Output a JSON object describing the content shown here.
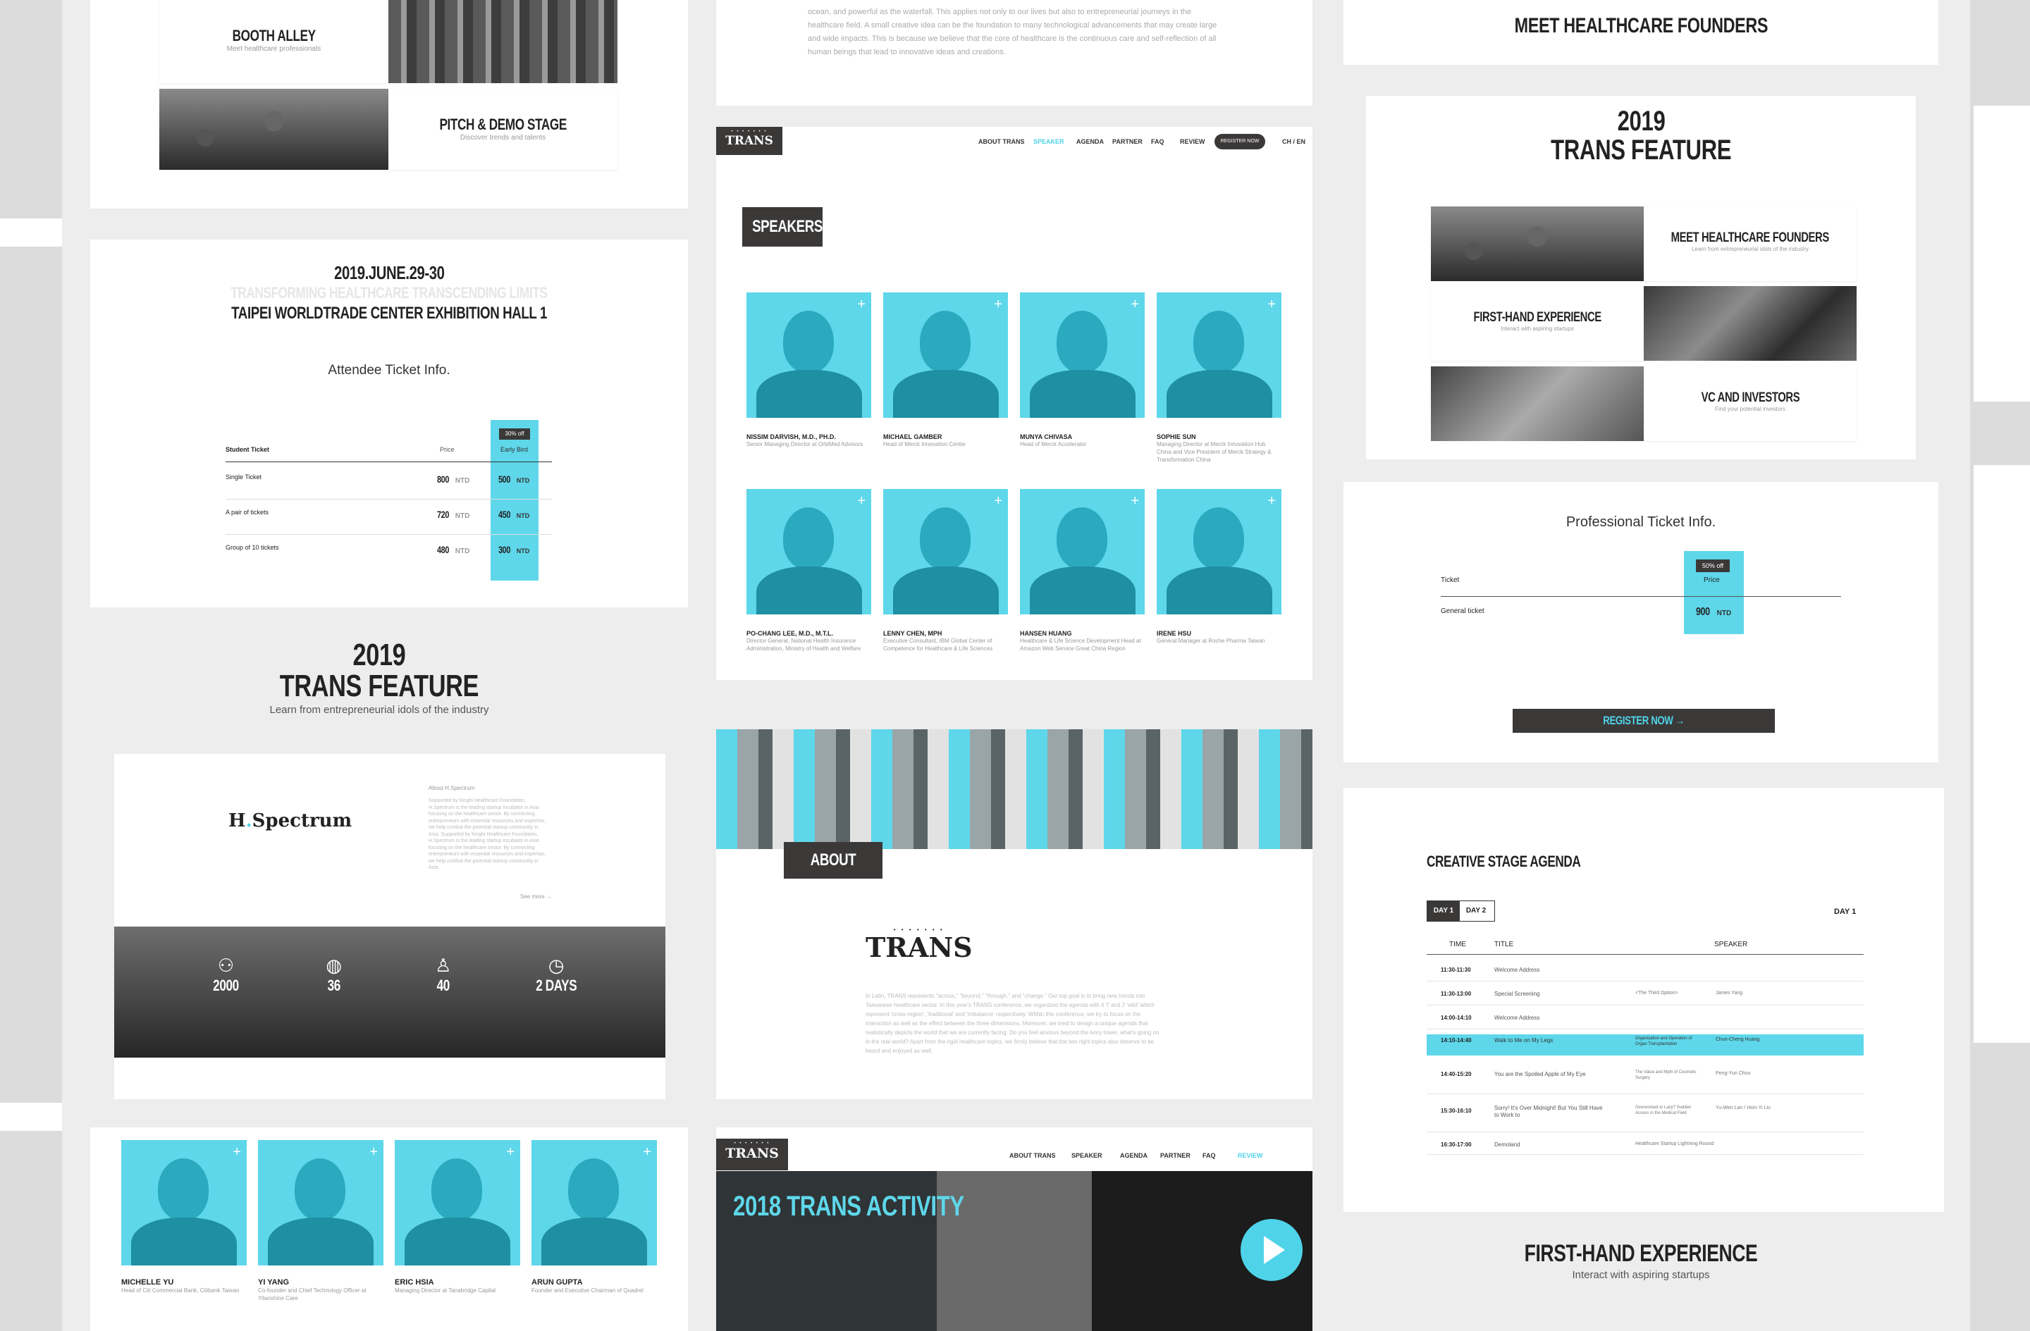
{
  "col1": {
    "booth_alley": {
      "title": "BOOTH ALLEY",
      "subtitle": "Meet healthcare professionals"
    },
    "pitch_demo": {
      "title": "PITCH & DEMO STAGE",
      "subtitle": "Discover trends and talents"
    },
    "event": {
      "date": "2019.JUNE.29-30",
      "tagline": "TRANSFORMING HEALTHCARE TRANSCENDING LIMITS",
      "venue": "TAIPEI WORLDTRADE CENTER EXHIBITION HALL 1",
      "ticket_heading": "Attendee Ticket Info.",
      "badge": "30% off",
      "columns": {
        "type": "Student Ticket",
        "price": "Price",
        "early": "Early Bird"
      },
      "rows": [
        {
          "label": "Single Ticket",
          "price": "800",
          "early": "500",
          "unit": "NTD"
        },
        {
          "label": "A pair of tickets",
          "price": "720",
          "early": "450",
          "unit": "NTD"
        },
        {
          "label": "Group of 10 tickets",
          "price": "480",
          "early": "300",
          "unit": "NTD"
        }
      ]
    },
    "feature": {
      "year": "2019",
      "title": "TRANS FEATURE",
      "subtitle": "Learn from entrepreneurial idols of the industry"
    },
    "spectrum": {
      "logo_prefix": "H",
      "logo_suffix": "Spectrum",
      "about_label": "About H.Spectrum",
      "body": "Supported by Kinghi Healthcare Foundation, H.Spectrum is the leading startup incubator in Asia focusing on the healthcare sector. By connecting entrepreneurs with essential resources and expertise, we help combat the potential startup community in Asia. Supported by Kinghi Healthcare Foundation, H.Spectrum is the leading startup incubator in Asia focusing on the healthcare sector. By connecting entrepreneurs with essential resources and expertise, we help combat the potential startup community in Asia.",
      "see_more": "See more →",
      "stats": [
        "2000",
        "36",
        "40",
        "2 DAYS"
      ]
    },
    "speakers_bottom": [
      {
        "name": "MICHELLE YU",
        "desc": "Head of Citi Commercial Bank, Citibank Taiwan"
      },
      {
        "name": "YI YANG",
        "desc": "Co-founder and Chief Technology Officer at Yitanshine Care"
      },
      {
        "name": "ERIC HSIA",
        "desc": "Managing Director at Tanabridge Capital"
      },
      {
        "name": "ARUN GUPTA",
        "desc": "Founder and Executive Chairman of Quadrel"
      }
    ]
  },
  "col2": {
    "intro_text": "ocean, and powerful as the waterfall. This applies not only to our lives but also to entrepreneurial journeys in the healthcare field. A small creative idea can be the foundation to many technological advancements that may create large and wide impacts. This is because we believe that the core of healthcare is the continuous care and self-reflection of all human beings that lead to innovative ideas and creations.",
    "nav": {
      "logo": "TRANS",
      "links": [
        "ABOUT TRANS",
        "SPEAKER",
        "AGENDA",
        "PARTNER",
        "FAQ",
        "REVIEW"
      ],
      "register": "REGISTER NOW",
      "lang": "CH / EN"
    },
    "speakers_title": "SPEAKERS",
    "speakers": [
      {
        "name": "NISSIM DARVISH, M.D., PH.D.",
        "desc": "Senior Managing Director at OrbiMed Advisors"
      },
      {
        "name": "MICHAEL GAMBER",
        "desc": "Head of Merck Innovation Center"
      },
      {
        "name": "MUNYA CHIVASA",
        "desc": "Head of Merck Accelerator"
      },
      {
        "name": "SOPHIE SUN",
        "desc": "Managing Director at Merck Innovation Hub China and Vice President of Merck Strategy & Transformation China"
      },
      {
        "name": "PO-CHANG LEE, M.D., M.T.L.",
        "desc": "Director General, National Health Insurance Administration, Ministry of Health and Welfare"
      },
      {
        "name": "LENNY CHEN, MPH",
        "desc": "Executive Consultant, IBM Global Center of Competence for Healthcare & Life Sciences"
      },
      {
        "name": "HANSEN HUANG",
        "desc": "Healthcare & Life Science Development Head at Amazon Web Service Great China Region"
      },
      {
        "name": "IRENE HSU",
        "desc": "General Manager at Roche Pharma Taiwan"
      }
    ],
    "about": {
      "tag": "ABOUT TRANS",
      "logo": "TRANS",
      "body": "In Latin, TRANS represents \"across,\" \"beyond,\" \"through,\" and \"change.\" Our top goal is to bring new trends into Taiwanese healthcare sector. In this year's TRANS conference, we organized the agenda with 4 'I' and 2 'wild' which represent 'cross-region', 'traditional' and 'imbalance' respectively. Within this conference, we try to focus on the interaction as well as the effect between the three dimensions. Moreover, we tried to design a unique agenda that realistically depicts the world that we are currently facing. Do you feel anxious beyond the ivory tower, what's going on in the real world? Apart from the rigid healthcare topics, we firmly believe that the two right topics also deserve to be heard and enjoyed as well."
    },
    "activity": {
      "nav_links": [
        "ABOUT TRANS",
        "SPEAKER",
        "AGENDA",
        "PARTNER",
        "FAQ",
        "REVIEW"
      ],
      "title": "2018 TRANS ACTIVITY"
    }
  },
  "col3": {
    "top_heading": "MEET HEALTHCARE FOUNDERS",
    "feature": {
      "year": "2019",
      "title": "TRANS FEATURE",
      "tiles": [
        {
          "title": "MEET HEALTHCARE FOUNDERS",
          "subtitle": "Learn from entrepreneurial idols of the industry"
        },
        {
          "title": "FIRST-HAND EXPERIENCE",
          "subtitle": "Interact with aspiring startups"
        },
        {
          "title": "VC AND INVESTORS",
          "subtitle": "Find your potential investors"
        }
      ]
    },
    "pro_ticket": {
      "heading": "Professional Ticket Info.",
      "badge": "50% off",
      "col_ticket": "Ticket",
      "col_price": "Price",
      "row_label": "General ticket",
      "row_price": "900",
      "unit": "NTD",
      "register": "REGISTER NOW →"
    },
    "agenda": {
      "heading": "CREATIVE STAGE AGENDA",
      "tabs": [
        "DAY 1",
        "DAY 2"
      ],
      "day_label": "DAY 1",
      "cols": [
        "TIME",
        "TITLE",
        "SPEAKER"
      ],
      "rows": [
        {
          "time": "11:30-11:30",
          "title": "Welcome Address",
          "sub": "",
          "speaker": ""
        },
        {
          "time": "11:30-13:00",
          "title": "Special Screening",
          "sub": "<The Third Option>",
          "speaker": "James Yang"
        },
        {
          "time": "14:00-14:10",
          "title": "Welcome Address",
          "sub": "",
          "speaker": ""
        },
        {
          "time": "14:10-14:40",
          "title": "Walk to Me on My Legs",
          "sub": "Organization and Operation of Organ Transplantation",
          "speaker": "Chun-Cheng Huang"
        },
        {
          "time": "14:40-15:20",
          "title": "You are the Spoiled Apple of My Eye",
          "sub": "The Value and Myth of Cosmetic Surgery",
          "speaker": "Peng-Yun Chou"
        },
        {
          "time": "15:30-16:10",
          "title": "Sorry! It's Over Midnight! But You Still Have to Work to",
          "sub": "Overworked or Lazy? Sudden Access in the Medical Field",
          "speaker": "Yu-Wen Lan / Hsin-Yi Liu"
        },
        {
          "time": "16:30-17:00",
          "title": "Demoland",
          "sub": "Healthcare Startup Lightning Round",
          "speaker": ""
        }
      ]
    },
    "first_hand": {
      "title": "FIRST-HAND EXPERIENCE",
      "subtitle": "Interact with aspiring startups"
    }
  }
}
